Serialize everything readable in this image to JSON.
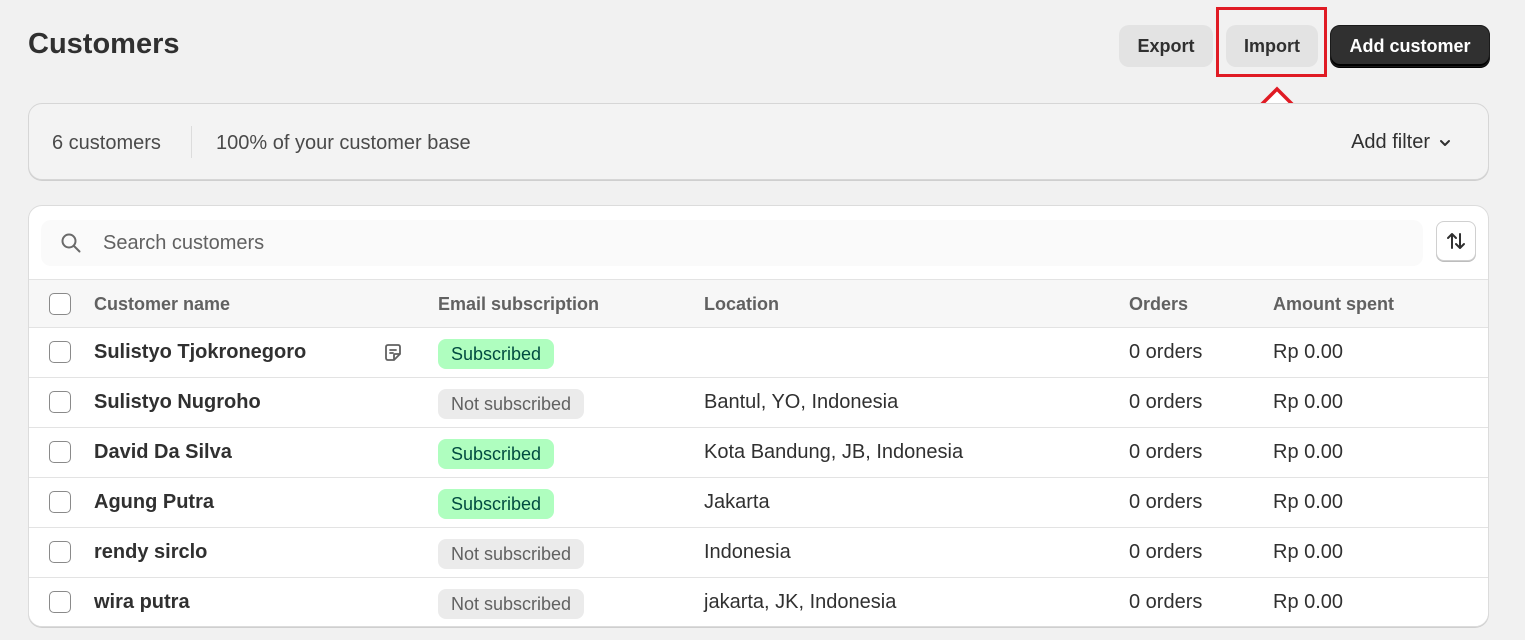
{
  "header": {
    "title": "Customers",
    "export_label": "Export",
    "import_label": "Import",
    "add_label": "Add customer"
  },
  "filter_bar": {
    "count": "6 customers",
    "base": "100% of your customer base",
    "add_filter": "Add filter"
  },
  "search": {
    "placeholder": "Search customers"
  },
  "table": {
    "headers": {
      "name": "Customer name",
      "email": "Email subscription",
      "location": "Location",
      "orders": "Orders",
      "amount": "Amount spent"
    },
    "rows": [
      {
        "name": "Sulistyo Tjokronegoro",
        "email": "Subscribed",
        "location": "",
        "orders": "0 orders",
        "amount": "Rp 0.00"
      },
      {
        "name": "Sulistyo Nugroho",
        "email": "Not subscribed",
        "location": "Bantul, YO, Indonesia",
        "orders": "0 orders",
        "amount": "Rp 0.00"
      },
      {
        "name": "David Da Silva",
        "email": "Subscribed",
        "location": "Kota Bandung, JB, Indonesia",
        "orders": "0 orders",
        "amount": "Rp 0.00"
      },
      {
        "name": "Agung Putra",
        "email": "Subscribed",
        "location": "Jakarta",
        "orders": "0 orders",
        "amount": "Rp 0.00"
      },
      {
        "name": "rendy sirclo",
        "email": "Not subscribed",
        "location": "Indonesia",
        "orders": "0 orders",
        "amount": "Rp 0.00"
      },
      {
        "name": "wira putra",
        "email": "Not subscribed",
        "location": "jakarta, JK, Indonesia",
        "orders": "0 orders",
        "amount": "Rp 0.00"
      }
    ]
  },
  "colors": {
    "background": "#f1f1f1",
    "primary_button": "#303030",
    "subscribed_badge": "#affebf",
    "not_subscribed_badge": "#ebebeb",
    "highlight": "#e01b24"
  },
  "icons": {
    "search": "search-icon",
    "sort": "sort-arrows-icon",
    "note": "note-icon",
    "chevron": "chevron-down-icon",
    "annotation_arrow": "up-arrow-icon"
  }
}
